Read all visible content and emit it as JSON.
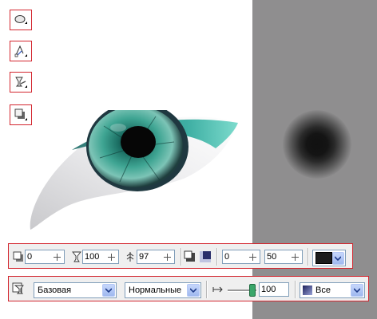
{
  "toolbar_top": {
    "offset_value": "0",
    "opacity_value": "100",
    "feather_value": "97",
    "x_value": "0",
    "y_value": "50",
    "shadow_color": "#1c1c1c"
  },
  "toolbar_bottom": {
    "opacity_type": "Базовая",
    "merge_mode": "Нормальные",
    "fade_value": "100",
    "channel": "Все"
  },
  "colors": {
    "border_highlight": "#d3262f",
    "canvas_gray": "#8f8e8f",
    "iris_teal": "#2aa79a"
  },
  "icons": [
    "ellipse-tool-icon",
    "pen-tool-icon",
    "transparency-tool-icon",
    "shadow-tool-icon"
  ]
}
